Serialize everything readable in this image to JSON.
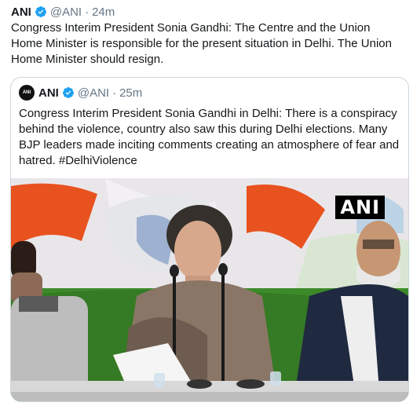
{
  "tweet": {
    "author_name": "ANI",
    "handle": "@ANI",
    "separator": "·",
    "time": "24m",
    "text": "Congress Interim President Sonia Gandhi: The Centre and the Union Home Minister is responsible for the present situation in Delhi. The Union Home Minister should resign."
  },
  "quoted_tweet": {
    "avatar_text": "ANI",
    "author_name": "ANI",
    "handle": "@ANI",
    "separator": "·",
    "time": "25m",
    "text": "Congress Interim President Sonia Gandhi in Delhi: There is a conspiracy behind the violence, country also saw this during Delhi elections. Many BJP leaders made inciting comments creating an atmosphere of fear and hatred.",
    "hashtag": "#DelhiViolence",
    "media": {
      "watermark": "ANI",
      "description_icon": "press-conference-photo"
    }
  },
  "colors": {
    "verified": "#1da1f2",
    "secondary_text": "#657786",
    "border": "#ccd6dd"
  }
}
